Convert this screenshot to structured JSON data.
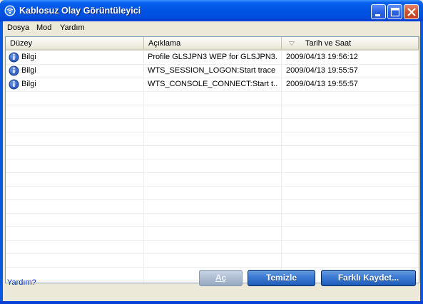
{
  "window": {
    "title": "Kablosuz Olay Görüntüleyici"
  },
  "menu": {
    "items": [
      "Dosya",
      "Mod",
      "Yardım"
    ]
  },
  "table": {
    "columns": [
      "Düzey",
      "Açıklama",
      "Tarih ve Saat"
    ],
    "sorted_column": "Tarih ve Saat",
    "rows": [
      {
        "level": "Bilgi",
        "description": "Profile GLSJPN3 WEP for GLSJPN3...",
        "datetime": "2009/04/13 19:56:12"
      },
      {
        "level": "Bilgi",
        "description": "WTS_SESSION_LOGON:Start trace",
        "datetime": "2009/04/13 19:55:57"
      },
      {
        "level": "Bilgi",
        "description": "WTS_CONSOLE_CONNECT:Start t...",
        "datetime": "2009/04/13 19:55:57"
      }
    ]
  },
  "footer": {
    "help_link": "Yardım?",
    "open_label": "Aç",
    "clear_label": "Temizle",
    "save_as_label": "Farklı Kaydet..."
  },
  "icons": {
    "title_icon": "wireless-network-icon",
    "row_icon": "info-icon",
    "sort_icon": "sort-descending-icon"
  },
  "colors": {
    "titlebar": "#0054e3",
    "button": "#3e7cd6",
    "link": "#0033cc"
  }
}
